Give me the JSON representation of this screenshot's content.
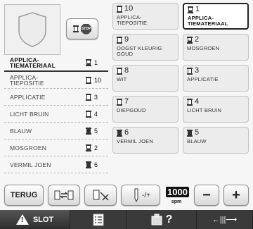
{
  "left_list": [
    {
      "label": "APPLICA-\nTIEMATERIAAL",
      "num": "1",
      "spool": "partial",
      "current": true
    },
    {
      "label": "APPLICA-\nTIEPOSITIE",
      "num": "10",
      "spool": "empty",
      "current": false
    },
    {
      "label": "APPLICATIE",
      "num": "3",
      "spool": "empty",
      "current": false
    },
    {
      "label": "LICHT BRUIN",
      "num": "4",
      "spool": "empty",
      "current": false
    },
    {
      "label": "BLAUW",
      "num": "5",
      "spool": "filled",
      "current": false
    },
    {
      "label": "MOSGROEN",
      "num": "2",
      "spool": "partial",
      "current": false
    },
    {
      "label": "VERMIL JOEN",
      "num": "6",
      "spool": "filled",
      "current": false
    }
  ],
  "stop_button": {
    "sign_text": "STOP"
  },
  "spools": [
    {
      "num": "10",
      "name": "APPLICA-\nTIEPOSITIE",
      "spool": "empty",
      "selected": false
    },
    {
      "num": "1",
      "name": "APPLICA-\nTIEMATERIAAL",
      "spool": "partial",
      "selected": true
    },
    {
      "num": "9",
      "name": "OOGST KLEURIG\nGOUD",
      "spool": "empty",
      "selected": false
    },
    {
      "num": "2",
      "name": "MOSGROEN",
      "spool": "partial",
      "selected": false
    },
    {
      "num": "8",
      "name": "WIT",
      "spool": "empty",
      "selected": false
    },
    {
      "num": "3",
      "name": "APPLICATIE",
      "spool": "empty",
      "selected": false
    },
    {
      "num": "7",
      "name": "DIEPGOUD",
      "spool": "empty",
      "selected": false
    },
    {
      "num": "4",
      "name": "LICHT BRUIN",
      "spool": "empty",
      "selected": false
    },
    {
      "num": "6",
      "name": "VERMIL JOEN",
      "spool": "filled",
      "selected": false
    },
    {
      "num": "5",
      "name": "BLAUW",
      "spool": "filled",
      "selected": false
    }
  ],
  "buttons": {
    "back_label": "TERUG",
    "speed_value": "1000",
    "speed_unit": "spm",
    "minus": "−",
    "plus": "+",
    "needle_label": "-/+"
  },
  "taskbar": {
    "slot_label": "SLOT",
    "help_glyph": "?",
    "nav_glyph": "←|||⟶"
  },
  "icons": [
    "shield-icon",
    "stop-icon",
    "spool-icon",
    "swap-color-icon",
    "thread-cut-icon",
    "needle-adjust-icon",
    "warning-icon",
    "checklist-icon",
    "help-icon",
    "navigation-icon"
  ],
  "colors": {
    "selected_border": "#222222",
    "cell_bg": "#ececec",
    "taskbar_bg": "#3a3a3a"
  }
}
